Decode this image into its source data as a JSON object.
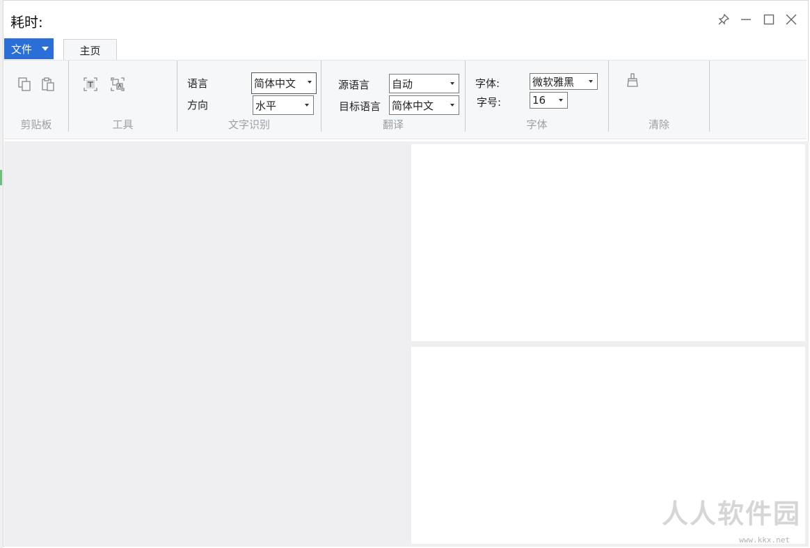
{
  "window": {
    "title": "耗时:"
  },
  "tabs": {
    "file_label": "文件",
    "home_label": "主页"
  },
  "ribbon": {
    "clipboard": {
      "label": "剪贴板"
    },
    "tools": {
      "label": "工具"
    },
    "ocr": {
      "label": "文字识别",
      "language_label": "语言",
      "language_value": "简体中文",
      "direction_label": "方向",
      "direction_value": "水平"
    },
    "translate": {
      "label": "翻译",
      "source_label": "源语言",
      "source_value": "自动",
      "target_label": "目标语言",
      "target_value": "简体中文"
    },
    "font": {
      "label": "字体",
      "family_label": "字体:",
      "family_value": "微软雅黑",
      "size_label": "字号:",
      "size_value": "16"
    },
    "clear": {
      "label": "清除"
    }
  },
  "watermark": {
    "text": "人人软件园",
    "url": "www.kkx.net"
  },
  "colors": {
    "accent": "#2a6fd8",
    "ribbon_bg": "#f6f7f9",
    "pane_bg": "#efeff1"
  }
}
